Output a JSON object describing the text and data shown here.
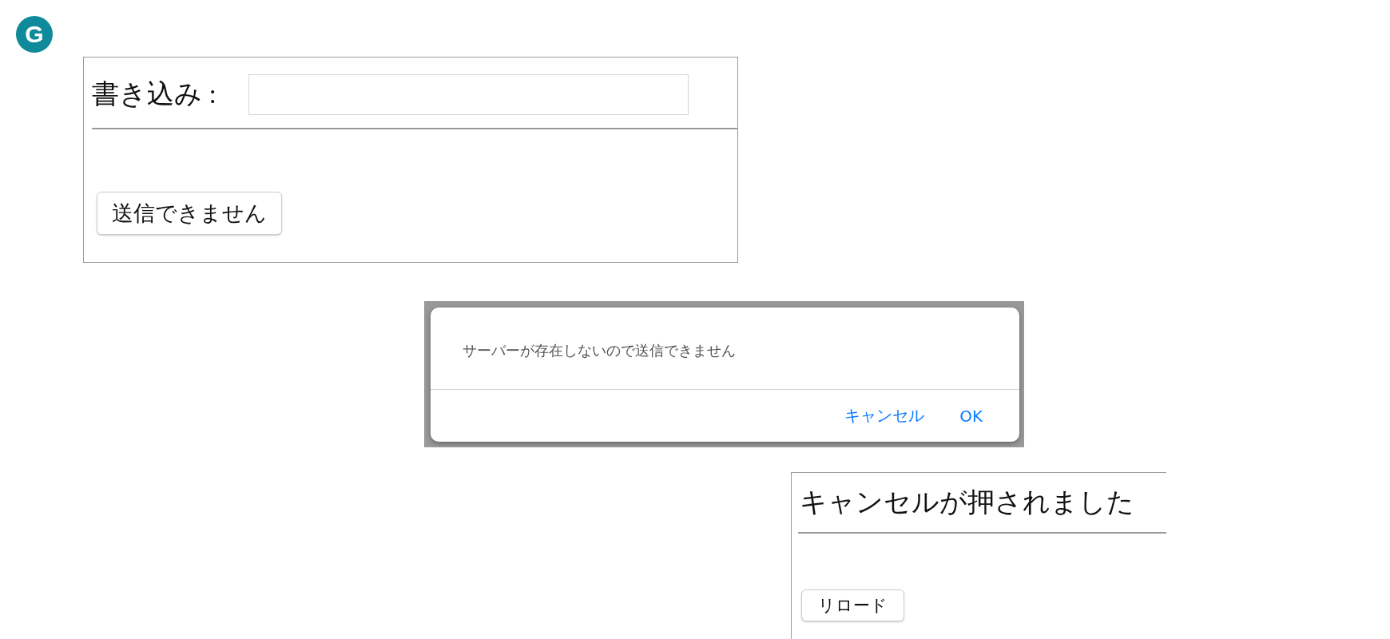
{
  "logo": {
    "letter": "G"
  },
  "form_panel": {
    "label": "書き込み :",
    "button": "送信できません"
  },
  "dialog": {
    "message": "サーバーが存在しないので送信できません",
    "buttons": [
      "キャンセル",
      "OK"
    ]
  },
  "result_panel": {
    "message": "キャンセルが押されました",
    "button": "リロード"
  }
}
